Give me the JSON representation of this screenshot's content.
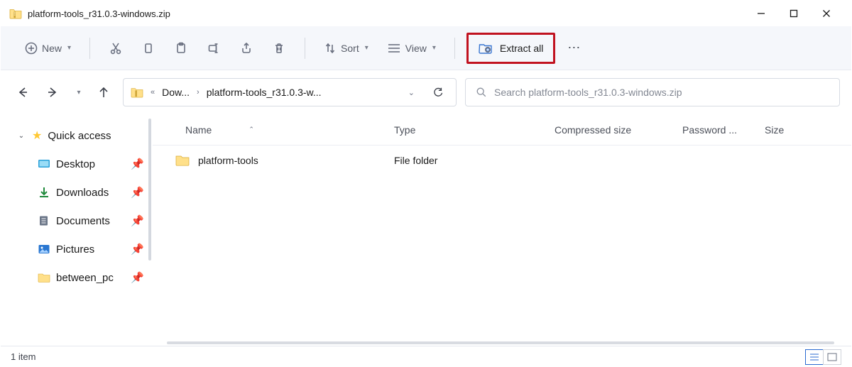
{
  "window": {
    "title": "platform-tools_r31.0.3-windows.zip"
  },
  "toolbar": {
    "new_label": "New",
    "sort_label": "Sort",
    "view_label": "View",
    "extract_label": "Extract all"
  },
  "breadcrumb": {
    "seg1": "Dow...",
    "seg2": "platform-tools_r31.0.3-w..."
  },
  "search": {
    "placeholder": "Search platform-tools_r31.0.3-windows.zip"
  },
  "sidebar": {
    "quick_access": "Quick access",
    "items": [
      {
        "label": "Desktop"
      },
      {
        "label": "Downloads"
      },
      {
        "label": "Documents"
      },
      {
        "label": "Pictures"
      },
      {
        "label": "between_pc"
      }
    ]
  },
  "columns": {
    "name": "Name",
    "type": "Type",
    "compressed": "Compressed size",
    "password": "Password ...",
    "size": "Size"
  },
  "rows": [
    {
      "name": "platform-tools",
      "type": "File folder"
    }
  ],
  "status": {
    "count": "1 item"
  }
}
